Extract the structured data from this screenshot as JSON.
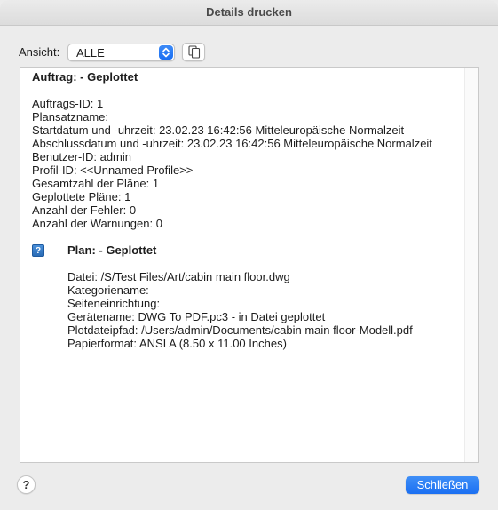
{
  "window": {
    "title": "Details drucken"
  },
  "toolbar": {
    "view_label": "Ansicht:",
    "view_select": {
      "value": "ALLE",
      "icon": "up-down-chevron-icon"
    },
    "copy_button": {
      "icon": "copy-icon"
    }
  },
  "job": {
    "title": "Auftrag: - Geplottet",
    "details": [
      "Auftrags-ID: 1",
      "Plansatzname:",
      "Startdatum und -uhrzeit: 23.02.23 16:42:56 Mitteleuropäische Normalzeit",
      "Abschlussdatum und -uhrzeit: 23.02.23 16:42:56 Mitteleuropäische Normalzeit",
      "Benutzer-ID: admin",
      "Profil-ID: <<Unnamed Profile>>",
      "Gesamtzahl der Pläne: 1",
      "Geplottete Pläne: 1",
      "Anzahl der Fehler: 0",
      "Anzahl der Warnungen: 0"
    ]
  },
  "plan": {
    "icon": "question-mark-icon",
    "icon_glyph": "?",
    "title": "Plan: - Geplottet",
    "details": [
      "Datei: /S/Test Files/Art/cabin main floor.dwg",
      "Kategoriename:",
      "Seiteneinrichtung:",
      "Gerätename: DWG To PDF.pc3 - in Datei geplottet",
      "Plotdateipfad: /Users/admin/Documents/cabin main floor-Modell.pdf",
      "Papierformat: ANSI A (8.50 x 11.00 Inches)"
    ]
  },
  "footer": {
    "help_label": "?",
    "close_label": "Schließen"
  },
  "colors": {
    "accent": "#1a6ff2",
    "window_bg": "#ececec",
    "content_bg": "#ffffff"
  }
}
